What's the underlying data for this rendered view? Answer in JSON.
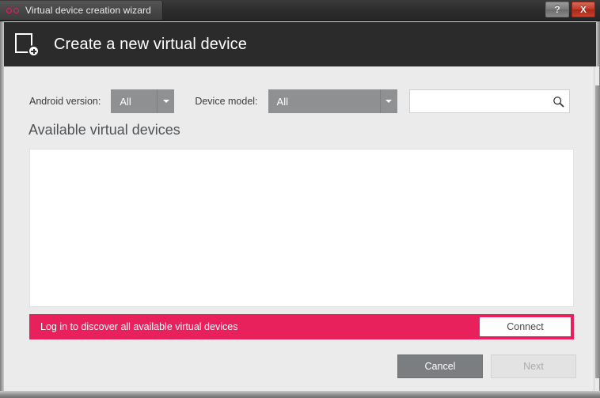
{
  "titlebar": {
    "title": "Virtual device creation wizard",
    "logo_icon": "genymotion-logo-icon",
    "help_label": "?",
    "help_icon": "help-icon",
    "close_label": "X",
    "close_icon": "close-icon"
  },
  "header": {
    "title": "Create a new virtual device",
    "icon": "new-device-icon"
  },
  "filters": {
    "android_version": {
      "label": "Android version:",
      "value": "All",
      "arrow_icon": "chevron-down-icon"
    },
    "device_model": {
      "label": "Device model:",
      "value": "All",
      "arrow_icon": "chevron-down-icon"
    },
    "search": {
      "value": "",
      "placeholder": "",
      "icon": "search-icon"
    }
  },
  "main": {
    "section_title": "Available virtual devices",
    "devices": []
  },
  "banner": {
    "message": "Log in to discover all available virtual devices",
    "connect_label": "Connect",
    "background_color": "#e8205c"
  },
  "footer": {
    "cancel_label": "Cancel",
    "next_label": "Next"
  }
}
